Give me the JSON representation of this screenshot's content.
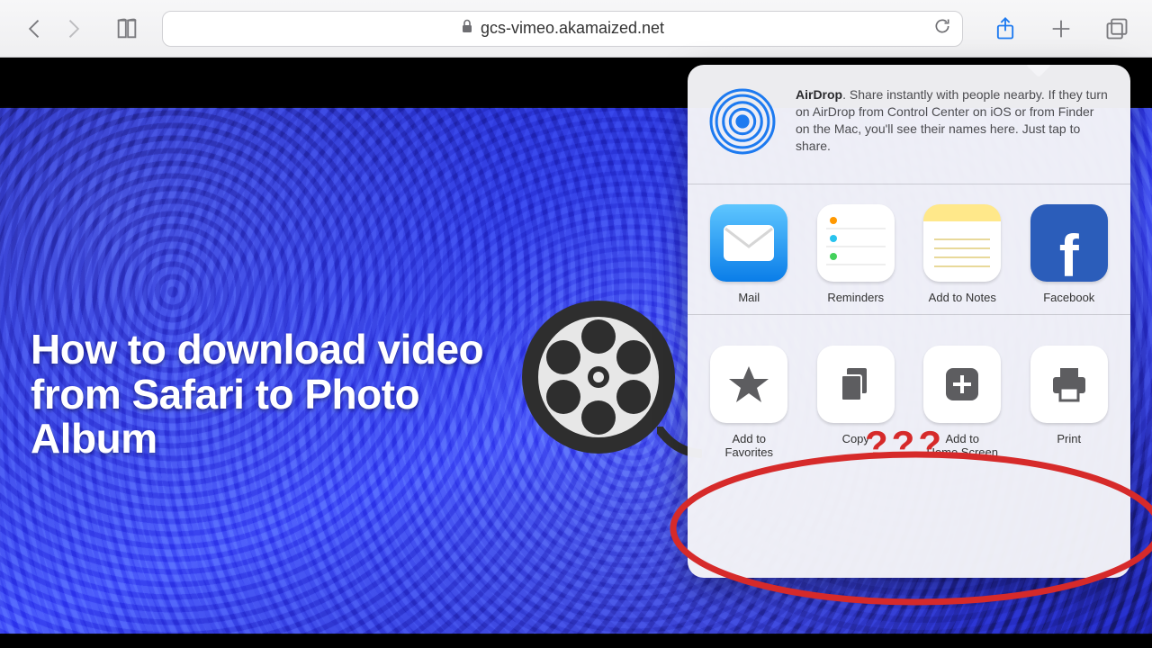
{
  "toolbar": {
    "url": "gcs-vimeo.akamaized.net"
  },
  "overlay": {
    "title": "How to download video from Safari to Photo Album"
  },
  "share": {
    "airdrop": {
      "title": "AirDrop",
      "text": ". Share instantly with people nearby. If they turn on AirDrop from Control Center on iOS or from Finder on the Mac, you'll see their names here. Just tap to share."
    },
    "apps": [
      {
        "label": "Mail"
      },
      {
        "label": "Reminders"
      },
      {
        "label": "Add to Notes"
      },
      {
        "label": "Facebook"
      }
    ],
    "actions": [
      {
        "label": "Add to Favorites"
      },
      {
        "label": "Copy"
      },
      {
        "label": "Add to\nHome Screen"
      },
      {
        "label": "Print"
      }
    ]
  },
  "annotation": {
    "question_marks": "???"
  }
}
